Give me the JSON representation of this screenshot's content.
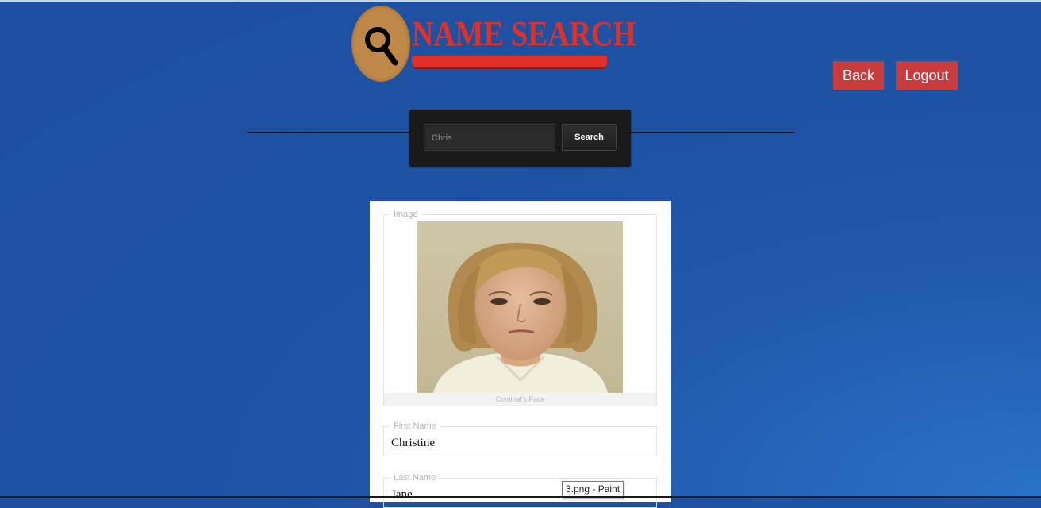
{
  "app": {
    "logo_text": "NAME SEARCH",
    "brand_color": "#e0302a",
    "logo_icon": "magnifier-icon"
  },
  "header": {
    "back_label": "Back",
    "logout_label": "Logout",
    "button_color": "#c93c3c"
  },
  "search": {
    "input_value": "Chris",
    "button_label": "Search"
  },
  "record": {
    "image_legend": "Image",
    "image_caption": "Criminal's Face",
    "first_name_legend": "First Name",
    "first_name_value": "Christine",
    "last_name_legend": "Last Name",
    "last_name_value": "Jane"
  },
  "tooltip": {
    "text": "3.png - Paint"
  }
}
